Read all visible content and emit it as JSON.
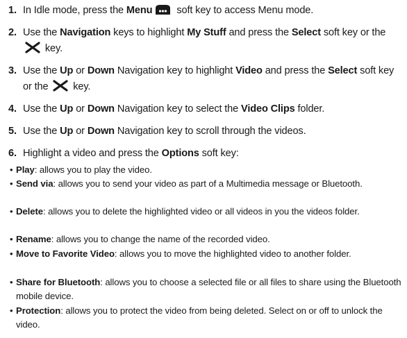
{
  "steps": [
    {
      "num": "1.",
      "t1": "In Idle mode, press the ",
      "b1": "Menu",
      "icon": "menu-key-icon",
      "t2": " soft key to access Menu mode."
    },
    {
      "num": "2.",
      "t1": "Use the ",
      "b1": "Navigation",
      "t2": " keys to highlight ",
      "b2": "My Stuff",
      "t3": " and press the ",
      "b3": "Select",
      "t4": " soft key or the ",
      "icon": "ok-key-icon",
      "t5": " key."
    },
    {
      "num": "3.",
      "t1": "Use the ",
      "b1": "Up",
      "t2": " or ",
      "b2": "Down",
      "t3": " Navigation key to highlight ",
      "b3": "Video",
      "t4": " and press the ",
      "b4": "Select",
      "t5": " soft key or the ",
      "icon": "ok-key-icon",
      "t6": " key."
    },
    {
      "num": "4.",
      "t1": "Use the ",
      "b1": "Up",
      "t2": " or ",
      "b2": "Down",
      "t3": " Navigation key to select the ",
      "b3": "Video Clips",
      "t4": " folder."
    },
    {
      "num": "5.",
      "t1": "Use the ",
      "b1": "Up",
      "t2": " or ",
      "b2": "Down",
      "t3": " Navigation key to scroll through the videos."
    },
    {
      "num": "6.",
      "t1": "Highlight a video and press the ",
      "b1": "Options",
      "t2": " soft key:"
    }
  ],
  "bullets": [
    {
      "dot": "•",
      "term": "Play",
      "desc": ": allows you to play the video."
    },
    {
      "dot": "•",
      "term": "Send via",
      "desc": ": allows you to send your video as part of a Multimedia message or Bluetooth."
    },
    {
      "dot": "•",
      "term": "Delete",
      "desc": ": allows you to delete the highlighted video or all videos in you the videos folder."
    },
    {
      "dot": "•",
      "term": "Rename",
      "desc": ": allows you to change the name of the recorded video."
    },
    {
      "dot": "•",
      "term": "Move to Favorite Video",
      "desc": ": allows you to move the highlighted video to another folder."
    },
    {
      "dot": "•",
      "term": "Share for Bluetooth",
      "desc": ": allows you to choose a selected file or all files to share using the Bluetooth mobile device."
    },
    {
      "dot": "•",
      "term": "Protection",
      "desc": ": allows you to protect the video from being deleted. Select on or off to unlock the video."
    }
  ]
}
